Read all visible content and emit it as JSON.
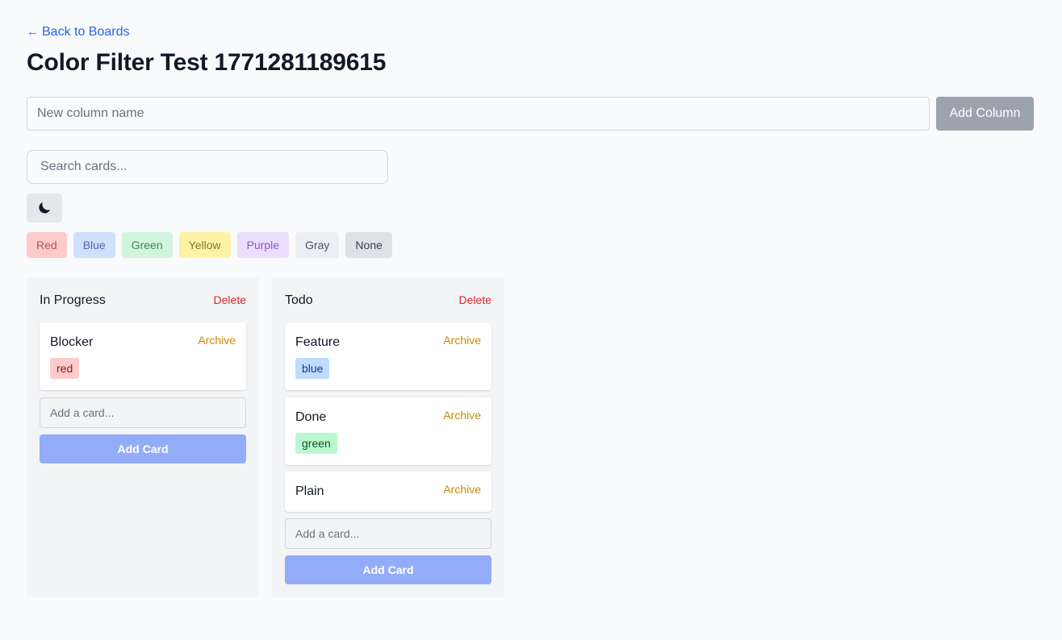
{
  "nav": {
    "back_arrow": "←",
    "back_label": "Back to Boards"
  },
  "board": {
    "title": "Color Filter Test 1771281189615"
  },
  "new_column": {
    "placeholder": "New column name",
    "button_label": "Add Column"
  },
  "search": {
    "placeholder": "Search cards..."
  },
  "theme_toggle": {
    "icon": "moon-icon"
  },
  "color_filters": [
    {
      "label": "Red",
      "bg": "#fecaca",
      "fg": "#b45454"
    },
    {
      "label": "Blue",
      "bg": "#cfe0fd",
      "fg": "#4b6bb0"
    },
    {
      "label": "Green",
      "bg": "#d0f5dc",
      "fg": "#3f8a5a"
    },
    {
      "label": "Yellow",
      "bg": "#fdf3a8",
      "fg": "#8a7420"
    },
    {
      "label": "Purple",
      "bg": "#ecdcfd",
      "fg": "#8a5bb8"
    },
    {
      "label": "Gray",
      "bg": "#eceef1",
      "fg": "#4b5563"
    },
    {
      "label": "None",
      "bg": "#dfe1e5",
      "fg": "#374151"
    }
  ],
  "columns": [
    {
      "title": "In Progress",
      "delete_label": "Delete",
      "cards": [
        {
          "title": "Blocker",
          "archive_label": "Archive",
          "tag": "red",
          "tag_bg": "#fecaca",
          "tag_fg": "#7f1d1d"
        }
      ],
      "add_card_placeholder": "Add a card...",
      "add_card_label": "Add Card"
    },
    {
      "title": "Todo",
      "delete_label": "Delete",
      "cards": [
        {
          "title": "Feature",
          "archive_label": "Archive",
          "tag": "blue",
          "tag_bg": "#bfdbfe",
          "tag_fg": "#1e3a8a"
        },
        {
          "title": "Done",
          "archive_label": "Archive",
          "tag": "green",
          "tag_bg": "#bbf7d0",
          "tag_fg": "#14532d"
        },
        {
          "title": "Plain",
          "archive_label": "Archive"
        }
      ],
      "add_card_placeholder": "Add a card...",
      "add_card_label": "Add Card"
    }
  ]
}
